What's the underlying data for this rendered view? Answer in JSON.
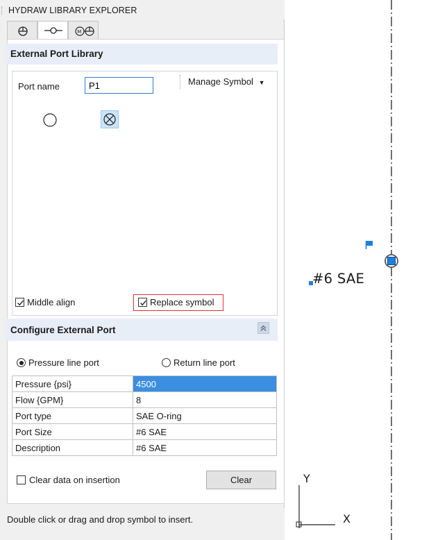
{
  "panel": {
    "title": "HYDRAW LIBRARY EXPLORER",
    "tabs": [
      {
        "icon": "pressure-symbol-icon",
        "active": false
      },
      {
        "icon": "port-symbol-icon",
        "active": true
      },
      {
        "icon": "motor-pump-icon",
        "active": false
      }
    ]
  },
  "library": {
    "heading": "External Port Library",
    "port_name_label": "Port name",
    "port_name_value": "P1",
    "manage_symbol_label": "Manage Symbol",
    "symbols": [
      "open-circle-port-icon",
      "crossed-circle-port-icon"
    ],
    "middle_align_label": "Middle align",
    "middle_align_checked": true,
    "replace_symbol_label": "Replace symbol",
    "replace_symbol_checked": true
  },
  "configure": {
    "heading": "Configure External Port",
    "radio_pressure_label": "Pressure line port",
    "radio_return_label": "Return line port",
    "selected_radio": "pressure",
    "properties": [
      {
        "key": "Pressure {psi}",
        "value": "4500",
        "selected": true
      },
      {
        "key": "Flow {GPM}",
        "value": "8",
        "selected": false
      },
      {
        "key": "Port type",
        "value": "SAE O-ring",
        "selected": false
      },
      {
        "key": "Port Size",
        "value": "#6 SAE",
        "selected": false
      },
      {
        "key": "Description",
        "value": "#6 SAE",
        "selected": false
      }
    ],
    "clear_on_insert_label": "Clear data on insertion",
    "clear_on_insert_checked": false,
    "clear_button_label": "Clear"
  },
  "status": {
    "hint": "Double click or drag and drop symbol to insert."
  },
  "canvas": {
    "port_annotation": "#6 SAE",
    "axis_y_label": "Y",
    "axis_x_label": "X",
    "accent_color": "#1e7fe0",
    "red_highlight": "#e0303a"
  }
}
